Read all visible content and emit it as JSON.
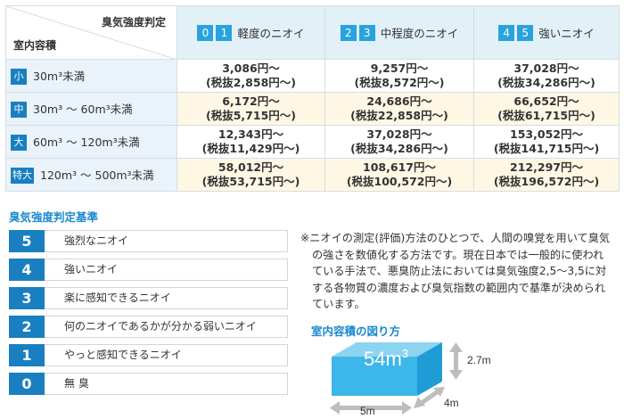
{
  "table": {
    "corner_top": "臭気強度判定",
    "corner_bottom": "室内容積",
    "columns": [
      {
        "nums": [
          "0",
          "1"
        ],
        "label": "軽度のニオイ"
      },
      {
        "nums": [
          "2",
          "3"
        ],
        "label": "中程度のニオイ"
      },
      {
        "nums": [
          "4",
          "5"
        ],
        "label": "強いニオイ"
      }
    ],
    "rows": [
      {
        "badge": "小",
        "size": "30m³未満",
        "prices": [
          [
            "3,086円〜",
            "(税抜2,858円〜)"
          ],
          [
            "9,257円〜",
            "(税抜8,572円〜)"
          ],
          [
            "37,028円〜",
            "(税抜34,286円〜)"
          ]
        ]
      },
      {
        "badge": "中",
        "size": "30m³ 〜 60m³未満",
        "prices": [
          [
            "6,172円〜",
            "(税抜5,715円〜)"
          ],
          [
            "24,686円〜",
            "(税抜22,858円〜)"
          ],
          [
            "66,652円〜",
            "(税抜61,715円〜)"
          ]
        ]
      },
      {
        "badge": "大",
        "size": "60m³ 〜 120m³未満",
        "prices": [
          [
            "12,343円〜",
            "(税抜11,429円〜)"
          ],
          [
            "37,028円〜",
            "(税抜34,286円〜)"
          ],
          [
            "153,052円〜",
            "(税抜141,715円〜)"
          ]
        ]
      },
      {
        "badge": "特大",
        "size": "120m³ 〜 500m³未満",
        "prices": [
          [
            "58,012円〜",
            "(税抜53,715円〜)"
          ],
          [
            "108,617円〜",
            "(税抜100,572円〜)"
          ],
          [
            "212,297円〜",
            "(税抜196,572円〜)"
          ]
        ]
      }
    ]
  },
  "criteria": {
    "title": "臭気強度判定基準",
    "levels": [
      {
        "num": "5",
        "label": "強烈なニオイ"
      },
      {
        "num": "4",
        "label": "強いニオイ"
      },
      {
        "num": "3",
        "label": "楽に感知できるニオイ"
      },
      {
        "num": "2",
        "label": "何のニオイであるかが分かる弱いニオイ"
      },
      {
        "num": "1",
        "label": "やっと感知できるニオイ"
      },
      {
        "num": "0",
        "label": "無 臭"
      }
    ]
  },
  "note": "※ニオイの測定(評価)方法のひとつで、人間の嗅覚を用いて臭気の強さを数値化する方法です。現在日本では一般的に使われている手法で、悪臭防止法においては臭気強度2,5〜3,5に対する各物質の濃度および臭気指数の範囲内で基準が決められています。",
  "diagram": {
    "title": "室内容積の図り方",
    "volume": "54m",
    "volume_exp": "3",
    "height": "2.7m",
    "width": "5m",
    "depth": "4m"
  },
  "colors": {
    "accent": "#1a88cf",
    "badge": "#1a7fc0",
    "header_bg": "#e2f0f8",
    "row_alt_bg": "#fdf7e4",
    "cube_front": "#3db6ea",
    "cube_top": "#8dd4f2"
  }
}
